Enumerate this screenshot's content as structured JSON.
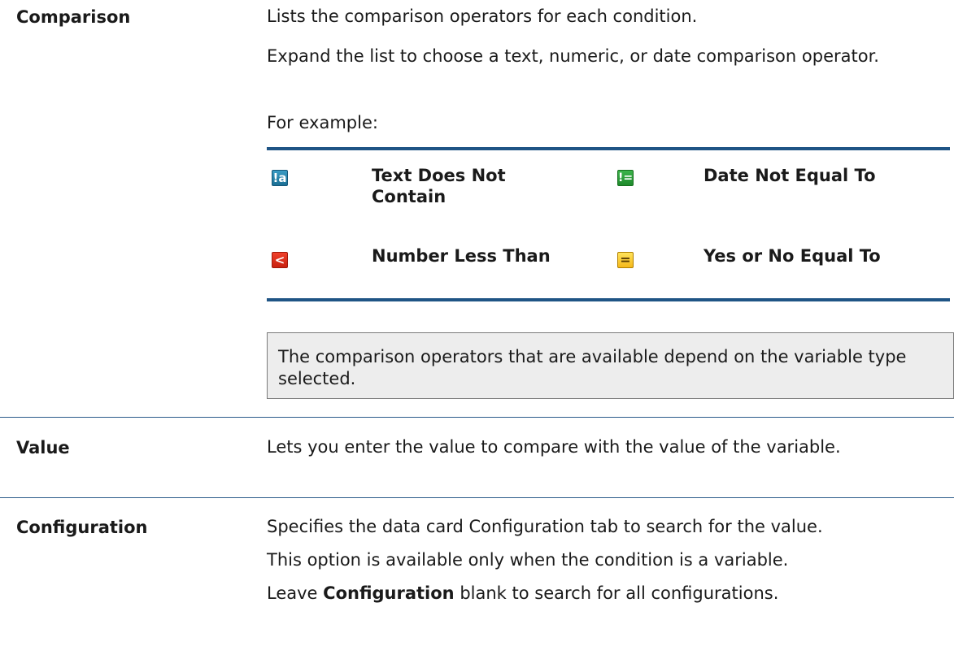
{
  "rows": [
    {
      "term": "Comparison",
      "paragraphs": [
        "Lists the comparison operators for each condition.",
        "Expand the list to choose a text, numeric, or date comparison operator.",
        "For example:"
      ]
    },
    {
      "term": "Value",
      "paragraphs": [
        "Lets you enter the value to compare with the value of the variable."
      ]
    },
    {
      "term": "Configuration",
      "paragraphs": [
        "Specifies the data card Configuration tab to search for the value.",
        "This option is available only when the condition is a variable."
      ],
      "leave": {
        "prefix": "Leave ",
        "bold": "Configuration",
        "suffix": " blank to search for all configurations."
      }
    }
  ],
  "operators": [
    {
      "icon": "text-not-contain-icon",
      "glyph": "!a",
      "label": "Text Does Not Contain",
      "color": "#1b6f94"
    },
    {
      "icon": "date-not-equal-icon",
      "glyph": "!=",
      "label": "Date Not Equal To",
      "color": "#1f8a2c"
    },
    {
      "icon": "number-less-than-icon",
      "glyph": "<",
      "label": "Number Less Than",
      "color": "#c8200f"
    },
    {
      "icon": "yes-no-equal-icon",
      "glyph": "=",
      "label": "Yes or No Equal To",
      "color": "#f5b81a"
    }
  ],
  "note": "The comparison operators that are available depend on the variable type selected.",
  "colors": {
    "rule": "#1f5485",
    "note_bg": "#ededed"
  }
}
